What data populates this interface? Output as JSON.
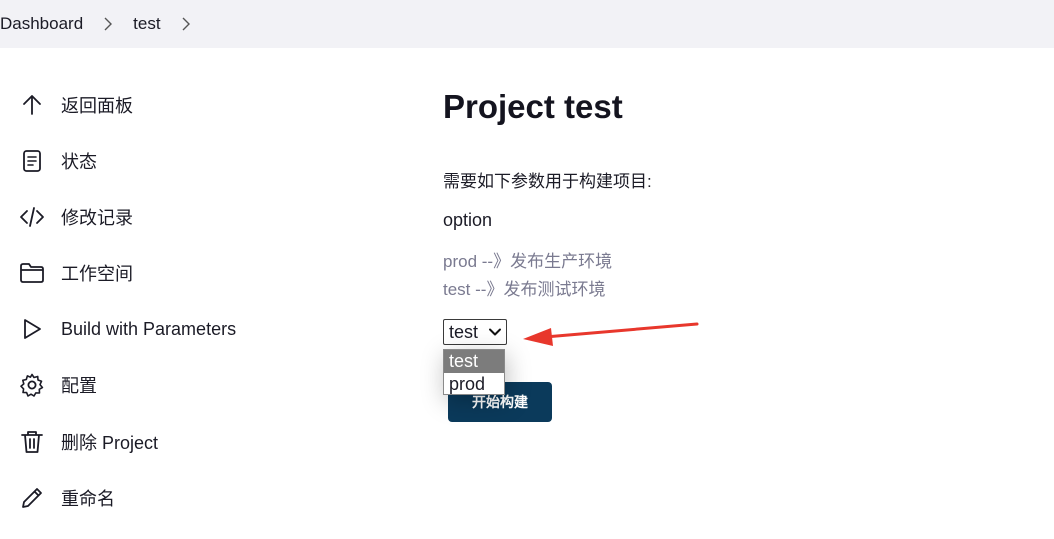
{
  "breadcrumb": {
    "items": [
      "Dashboard",
      "test"
    ]
  },
  "sidebar": {
    "items": [
      {
        "label": "返回面板",
        "icon": "arrow-up-icon"
      },
      {
        "label": "状态",
        "icon": "document-icon"
      },
      {
        "label": "修改记录",
        "icon": "code-icon"
      },
      {
        "label": "工作空间",
        "icon": "folder-icon"
      },
      {
        "label": "Build with Parameters",
        "icon": "play-icon"
      },
      {
        "label": "配置",
        "icon": "gear-icon"
      },
      {
        "label": "删除 Project",
        "icon": "trash-icon"
      },
      {
        "label": "重命名",
        "icon": "pencil-icon"
      }
    ]
  },
  "main": {
    "title": "Project test",
    "description": "需要如下参数用于构建项目:",
    "parameter": {
      "name": "option",
      "help_lines": [
        "prod --》发布生产环境",
        "test --》发布测试环境"
      ],
      "selected": "test",
      "options": [
        "test",
        "prod"
      ]
    },
    "build_button": "开始构建"
  },
  "colors": {
    "breadcrumb_bg": "#f2f2f6",
    "button_bg": "#0b3a5b",
    "annotation_arrow": "#e8372c"
  }
}
